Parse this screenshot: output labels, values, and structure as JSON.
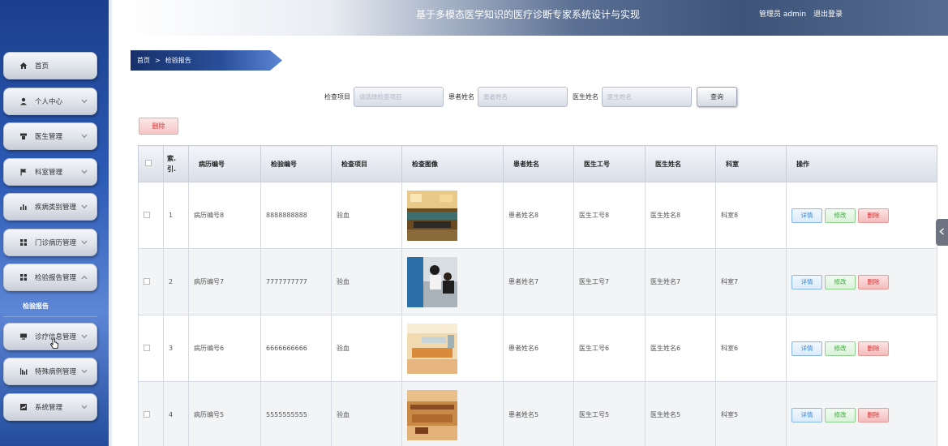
{
  "app": {
    "title": "基于多模态医学知识的医疗诊断专家系统设计与实现",
    "user": "管理员 admin",
    "logout": "退出登录"
  },
  "sidebar": {
    "items": [
      {
        "label": "首页",
        "icon": "home-icon"
      },
      {
        "label": "个人中心",
        "icon": "user-icon"
      },
      {
        "label": "医生管理",
        "icon": "doctor-icon"
      },
      {
        "label": "科室管理",
        "icon": "flag-icon"
      },
      {
        "label": "疾病类别管理",
        "icon": "bar-chart-icon"
      },
      {
        "label": "门诊病历管理",
        "icon": "grid-icon"
      },
      {
        "label": "检验报告管理",
        "icon": "grid-icon"
      },
      {
        "label": "诊疗信息管理",
        "icon": "monitor-icon"
      },
      {
        "label": "特殊病例管理",
        "icon": "chart-icon"
      },
      {
        "label": "系统管理",
        "icon": "settings-chart-icon"
      }
    ],
    "submenu": "检验报告"
  },
  "breadcrumb": {
    "home": "首页",
    "sep": ">",
    "current": "检验报告"
  },
  "search": {
    "item_label": "检查项目",
    "item_placeholder": "请选择检查项目",
    "patient_label": "患者姓名",
    "patient_placeholder": "患者姓名",
    "doctor_label": "医生姓名",
    "doctor_placeholder": "医生姓名",
    "query": "查询"
  },
  "toolbar": {
    "delete": "删除"
  },
  "table": {
    "headers": [
      "",
      "索引",
      "病历编号",
      "检验编号",
      "检查项目",
      "检查图像",
      "患者姓名",
      "医生工号",
      "医生姓名",
      "科室",
      "操作"
    ],
    "header_index_line1": "索.",
    "header_index_line2": "引.",
    "rows": [
      {
        "index": "1",
        "record_no": "病历编号8",
        "test_no": "8888888888",
        "item": "验血",
        "patient": "患者姓名8",
        "doctor_id": "医生工号8",
        "doctor": "医生姓名8",
        "dept": "科室8",
        "image": "lobby-photo"
      },
      {
        "index": "2",
        "record_no": "病历编号7",
        "test_no": "7777777777",
        "item": "验血",
        "patient": "患者姓名7",
        "doctor_id": "医生工号7",
        "doctor": "医生姓名7",
        "dept": "科室7",
        "image": "consult-photo"
      },
      {
        "index": "3",
        "record_no": "病历编号6",
        "test_no": "6666666666",
        "item": "验血",
        "patient": "患者姓名6",
        "doctor_id": "医生工号6",
        "doctor": "医生姓名6",
        "dept": "科室6",
        "image": "reception-photo"
      },
      {
        "index": "4",
        "record_no": "病历编号5",
        "test_no": "5555555555",
        "item": "验血",
        "patient": "患者姓名5",
        "doctor_id": "医生工号5",
        "doctor": "医生姓名5",
        "dept": "科室5",
        "image": "waiting-photo"
      }
    ],
    "actions": {
      "detail": "详情",
      "edit": "修改",
      "delete": "删除"
    }
  },
  "colors": {
    "sidebar": "#2c5bb5",
    "header_dark": "#3d5378",
    "accent_blue": "#3a86cf",
    "accent_green": "#3ea43e",
    "accent_red": "#cf3131"
  }
}
